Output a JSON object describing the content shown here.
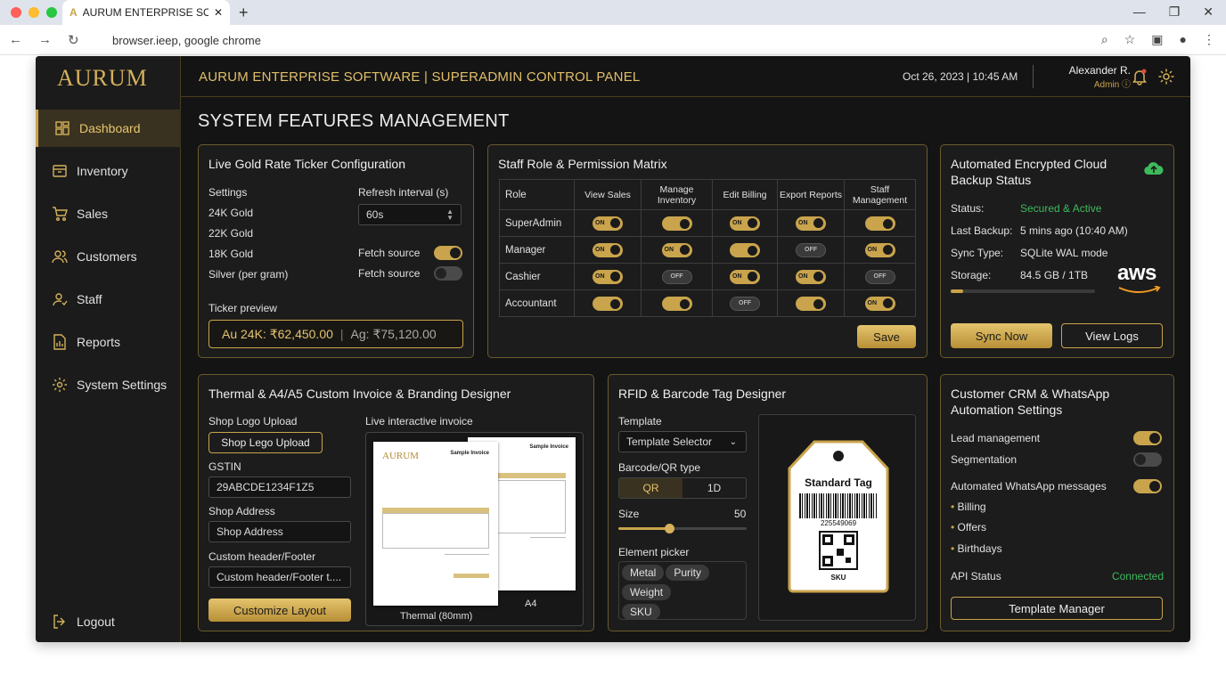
{
  "browser": {
    "tab_title": "AURUM ENTERPRISE SOFTWA",
    "url": "browser.ieep, google chrome"
  },
  "app": {
    "logo": "AURUM",
    "title": "AURUM ENTERPRISE SOFTWARE | SUPERADMIN CONTROL PANEL",
    "datetime": "Oct 26, 2023 | 10:45 AM",
    "user": "Alexander R.",
    "role": "Admin"
  },
  "sidebar": {
    "items": [
      {
        "label": "Dashboard"
      },
      {
        "label": "Inventory"
      },
      {
        "label": "Sales"
      },
      {
        "label": "Customers"
      },
      {
        "label": "Staff"
      },
      {
        "label": "Reports"
      },
      {
        "label": "System Settings"
      }
    ],
    "logout": "Logout"
  },
  "page_title": "SYSTEM FEATURES MANAGEMENT",
  "gold": {
    "title": "Live Gold Rate Ticker Configuration",
    "settings_label": "Settings",
    "refresh_label": "Refresh interval (s)",
    "refresh_value": "60s",
    "metals": [
      "24K Gold",
      "22K Gold",
      "18K Gold",
      "Silver (per gram)"
    ],
    "fetch1": "Fetch source",
    "fetch2": "Fetch source",
    "preview_label": "Ticker preview",
    "au": "Au 24K: ₹62,450.00",
    "ag": "Ag: ₹75,120.00"
  },
  "matrix": {
    "title": "Staff Role & Permission Matrix",
    "headers": [
      "Role",
      "View Sales",
      "Manage Inventory",
      "Edit Billing",
      "Export Reports",
      "Staff Management"
    ],
    "rows": [
      {
        "role": "SuperAdmin",
        "cells": [
          "ON",
          "",
          "ON",
          "ON",
          ""
        ]
      },
      {
        "role": "Manager",
        "cells": [
          "ON",
          "ON",
          "",
          "OFF",
          "ON"
        ]
      },
      {
        "role": "Cashier",
        "cells": [
          "ON",
          "OFF",
          "ON",
          "ON",
          "OFF"
        ]
      },
      {
        "role": "Accountant",
        "cells": [
          "",
          "",
          "OFF",
          "",
          "ON"
        ]
      }
    ],
    "save": "Save"
  },
  "backup": {
    "title": "Automated Encrypted Cloud Backup Status",
    "status_label": "Status:",
    "status_value": "Secured & Active",
    "last_label": "Last Backup:",
    "last_value": "5 mins ago (10:40 AM)",
    "sync_label": "Sync Type:",
    "sync_value": "SQLite WAL mode",
    "storage_label": "Storage:",
    "storage_value": "84.5 GB / 1TB",
    "storage_fraction": 0.085,
    "aws": "aws",
    "sync_btn": "Sync Now",
    "logs_btn": "View Logs"
  },
  "invoice": {
    "title": "Thermal & A4/A5 Custom Invoice & Branding Designer",
    "logo_label": "Shop Logo Upload",
    "logo_btn": "Shop Lego Upload",
    "gstin_label": "GSTIN",
    "gstin_value": "29ABCDE1234F1Z5",
    "addr_label": "Shop Address",
    "addr_value": "Shop Address",
    "custom_label": "Custom header/Footer",
    "custom_value": "Custom header/Footer t....",
    "customize_btn": "Customize Layout",
    "live_label": "Live interactive invoice",
    "thermal_caption": "Thermal (80mm)",
    "a4_caption": "A4",
    "sample_title": "Sample Invoice",
    "sample_title2": "Sample Invoice",
    "brand": "AURUM"
  },
  "rfid": {
    "title": "RFID & Barcode Tag Designer",
    "template_label": "Template",
    "template_value": "Template Selector",
    "barcode_label": "Barcode/QR type",
    "qr": "QR",
    "one_d": "1D",
    "size_label": "Size",
    "size_value": "50",
    "size_fraction": 0.4,
    "picker_label": "Element picker",
    "chips": [
      "Metal",
      "Purity",
      "Weight",
      "SKU"
    ],
    "tag_title": "Standard Tag",
    "tag_number": "225549069",
    "tag_sku": "SKU"
  },
  "crm": {
    "title": "Customer CRM & WhatsApp Automation Settings",
    "lead": "Lead management",
    "segmentation": "Segmentation",
    "whatsapp": "Automated WhatsApp messages",
    "bullets": [
      "Billing",
      "Offers",
      "Birthdays"
    ],
    "api_label": "API Status",
    "api_value": "Connected",
    "template_btn": "Template Manager"
  }
}
